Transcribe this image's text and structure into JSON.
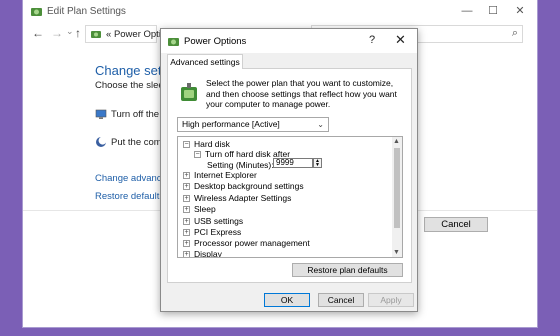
{
  "background_window": {
    "title": "Edit Plan Settings",
    "window_controls": {
      "minimize": "—",
      "maximize": "☐",
      "close": "✕"
    },
    "nav": {
      "back": "←",
      "forward": "→",
      "recent": "⌄",
      "up": "↑"
    },
    "address": {
      "chevron": "«",
      "text": "Power Opti..."
    },
    "search_icon": "magnifier-icon",
    "heading": "Change setting",
    "subtext": "Choose the sleep ar",
    "rows": [
      {
        "icon": "monitor-icon",
        "label": "Turn off the dis"
      },
      {
        "icon": "moon-icon",
        "label": "Put the compu"
      }
    ],
    "links": [
      "Change advanced p",
      "Restore default setti"
    ],
    "cancel_label": "Cancel"
  },
  "dialog": {
    "title": "Power Options",
    "help": "?",
    "close": "✕",
    "tab_label": "Advanced settings",
    "description": "Select the power plan that you want to customize, and then choose settings that reflect how you want your computer to manage power.",
    "plan_selected": "High performance [Active]",
    "tree": {
      "items": [
        {
          "label": "Hard disk",
          "expander": "⊟"
        },
        {
          "label": "Turn off hard disk after",
          "expander": "⊟"
        },
        {
          "label": "Setting (Minutes):"
        },
        {
          "label": "Internet Explorer",
          "expander": "⊞"
        },
        {
          "label": "Desktop background settings",
          "expander": "⊞"
        },
        {
          "label": "Wireless Adapter Settings",
          "expander": "⊞"
        },
        {
          "label": "Sleep",
          "expander": "⊞"
        },
        {
          "label": "USB settings",
          "expander": "⊞"
        },
        {
          "label": "PCI Express",
          "expander": "⊞"
        },
        {
          "label": "Processor power management",
          "expander": "⊞"
        },
        {
          "label": "Display",
          "expander": "⊞"
        }
      ],
      "minutes_value": "9999"
    },
    "restore_label": "Restore plan defaults",
    "buttons": {
      "ok": "OK",
      "cancel": "Cancel",
      "apply": "Apply"
    }
  },
  "colors": {
    "desktop": "#7b5fb6",
    "link": "#1f5fa8",
    "focus_border": "#0078d7"
  }
}
